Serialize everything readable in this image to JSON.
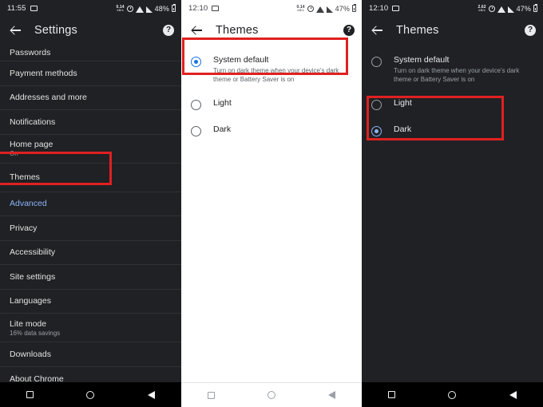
{
  "panels": [
    {
      "id": "settings",
      "theme": "dark",
      "status": {
        "time": "11:55",
        "data_rate_top": "0.14",
        "data_rate_unit": "kB/s",
        "battery_pct": "48%"
      },
      "appbar": {
        "title": "Settings",
        "back_icon": "back-arrow-icon",
        "help_icon": "help-icon"
      },
      "rows": [
        {
          "title": "Passwords",
          "subtitle": "",
          "type": "item"
        },
        {
          "title": "Payment methods",
          "subtitle": "",
          "type": "item"
        },
        {
          "title": "Addresses and more",
          "subtitle": "",
          "type": "item"
        },
        {
          "title": "Notifications",
          "subtitle": "",
          "type": "item"
        },
        {
          "title": "Home page",
          "subtitle": "On",
          "type": "item"
        },
        {
          "title": "Themes",
          "subtitle": "",
          "type": "item"
        },
        {
          "title": "Advanced",
          "subtitle": "",
          "type": "link"
        },
        {
          "title": "Privacy",
          "subtitle": "",
          "type": "item"
        },
        {
          "title": "Accessibility",
          "subtitle": "",
          "type": "item"
        },
        {
          "title": "Site settings",
          "subtitle": "",
          "type": "item"
        },
        {
          "title": "Languages",
          "subtitle": "",
          "type": "item"
        },
        {
          "title": "Lite mode",
          "subtitle": "16% data savings",
          "type": "item"
        },
        {
          "title": "Downloads",
          "subtitle": "",
          "type": "item"
        },
        {
          "title": "About Chrome",
          "subtitle": "",
          "type": "item"
        }
      ],
      "highlight": "Themes"
    },
    {
      "id": "themes-light",
      "theme": "light",
      "status": {
        "time": "12:10",
        "data_rate_top": "0.14",
        "data_rate_unit": "kB/s",
        "battery_pct": "47%"
      },
      "appbar": {
        "title": "Themes",
        "back_icon": "back-arrow-icon",
        "help_icon": "help-icon"
      },
      "options": [
        {
          "label": "System default",
          "description": "Turn on dark theme when your device's dark theme or Battery Saver is on",
          "selected": true
        },
        {
          "label": "Light",
          "description": "",
          "selected": false
        },
        {
          "label": "Dark",
          "description": "",
          "selected": false
        }
      ],
      "highlight": "System default"
    },
    {
      "id": "themes-dark",
      "theme": "dark",
      "status": {
        "time": "12:10",
        "data_rate_top": "2.62",
        "data_rate_unit": "kB/s",
        "battery_pct": "47%"
      },
      "appbar": {
        "title": "Themes",
        "back_icon": "back-arrow-icon",
        "help_icon": "help-icon"
      },
      "options": [
        {
          "label": "System default",
          "description": "Turn on dark theme when your device's dark theme or Battery Saver is on",
          "selected": false
        },
        {
          "label": "Light",
          "description": "",
          "selected": false
        },
        {
          "label": "Dark",
          "description": "",
          "selected": true
        }
      ],
      "highlight": "Dark"
    }
  ],
  "navbar": {
    "recents_icon": "square-recents-icon",
    "home_icon": "circle-home-icon",
    "back_icon": "triangle-back-icon"
  },
  "colors": {
    "accent_light": "#1a73e8",
    "accent_dark": "#8ab4f8",
    "annotation": "#e02020",
    "dark_bg": "#202124",
    "light_bg": "#ffffff"
  },
  "help_glyph": "?"
}
